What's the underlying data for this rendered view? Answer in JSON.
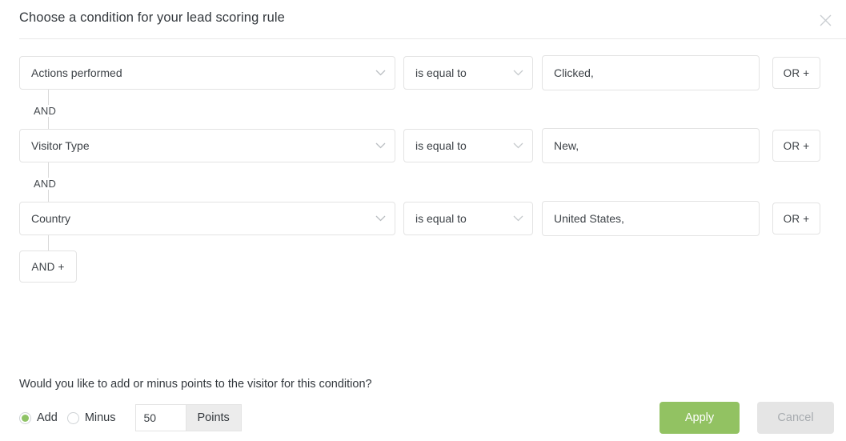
{
  "header": {
    "title": "Choose a condition for your lead scoring rule",
    "close_icon": "close-icon"
  },
  "conditions": {
    "connector_label": "AND",
    "or_button_label": "OR +",
    "add_condition_label": "AND +",
    "rows": [
      {
        "field": "Actions performed",
        "operator": "is equal to",
        "value": "Clicked,",
        "value_placeholder": "",
        "or_label": "OR +"
      },
      {
        "field": "Visitor Type",
        "operator": "is equal to",
        "value": "New,",
        "value_placeholder": "",
        "or_label": "OR +"
      },
      {
        "field": "Country",
        "operator": "is equal to",
        "value": "United States,",
        "value_placeholder": "",
        "or_label": "OR +"
      }
    ]
  },
  "points": {
    "question": "Would you like to add or minus points to the visitor for this condition?",
    "add_label": "Add",
    "minus_label": "Minus",
    "selected_mode": "Add",
    "value": "50",
    "placeholder": "",
    "unit_label": "Points"
  },
  "footer": {
    "apply_label": "Apply",
    "cancel_label": "Cancel"
  },
  "colors": {
    "accent_green": "#92c262",
    "cancel_gray": "#e5e5e5",
    "border": "#e3e3e3"
  }
}
